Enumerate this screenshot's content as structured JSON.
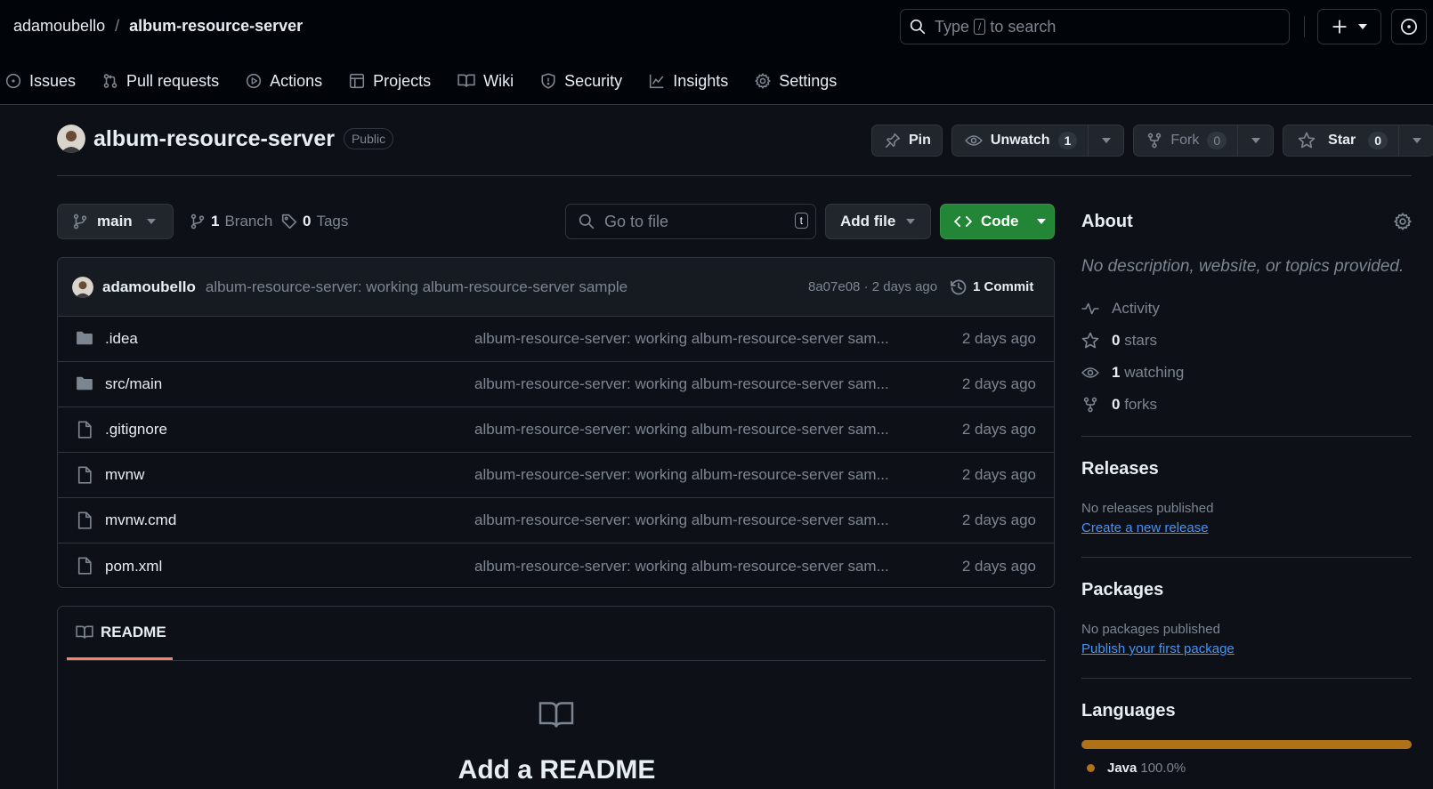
{
  "header": {
    "owner": "adamoubello",
    "separator": "/",
    "repo": "album-resource-server",
    "search_prefix": "Type",
    "search_key": "/",
    "search_suffix": "to search"
  },
  "nav_tabs": [
    {
      "label": "Issues",
      "icon": "issue-icon"
    },
    {
      "label": "Pull requests",
      "icon": "pull-request-icon"
    },
    {
      "label": "Actions",
      "icon": "play-icon"
    },
    {
      "label": "Projects",
      "icon": "table-icon"
    },
    {
      "label": "Wiki",
      "icon": "book-icon"
    },
    {
      "label": "Security",
      "icon": "shield-icon"
    },
    {
      "label": "Insights",
      "icon": "graph-icon"
    },
    {
      "label": "Settings",
      "icon": "gear-icon"
    }
  ],
  "repo_header": {
    "name": "album-resource-server",
    "visibility": "Public",
    "pin_label": "Pin",
    "watch_label": "Unwatch",
    "watch_count": "1",
    "fork_label": "Fork",
    "fork_count": "0",
    "star_label": "Star",
    "star_count": "0"
  },
  "toolbar": {
    "branch": "main",
    "branch_count": "1",
    "branch_label": "Branch",
    "tag_count": "0",
    "tag_label": "Tags",
    "goto_placeholder": "Go to file",
    "goto_key": "t",
    "add_file_label": "Add file",
    "code_label": "Code"
  },
  "latest_commit": {
    "author": "adamoubello",
    "message": "album-resource-server: working album-resource-server sample",
    "hash_time": "8a07e08 · 2 days ago",
    "commit_count": "1 Commit"
  },
  "files": [
    {
      "name": ".idea",
      "type": "folder",
      "message": "album-resource-server: working album-resource-server sam...",
      "date": "2 days ago"
    },
    {
      "name": "src/main",
      "type": "folder",
      "message": "album-resource-server: working album-resource-server sam...",
      "date": "2 days ago"
    },
    {
      "name": ".gitignore",
      "type": "file",
      "message": "album-resource-server: working album-resource-server sam...",
      "date": "2 days ago"
    },
    {
      "name": "mvnw",
      "type": "file",
      "message": "album-resource-server: working album-resource-server sam...",
      "date": "2 days ago"
    },
    {
      "name": "mvnw.cmd",
      "type": "file",
      "message": "album-resource-server: working album-resource-server sam...",
      "date": "2 days ago"
    },
    {
      "name": "pom.xml",
      "type": "file",
      "message": "album-resource-server: working album-resource-server sam...",
      "date": "2 days ago"
    }
  ],
  "readme": {
    "tab_label": "README",
    "title": "Add a README"
  },
  "sidebar": {
    "about_title": "About",
    "about_desc": "No description, website, or topics provided.",
    "activity_label": "Activity",
    "stars_count": "0",
    "stars_label": "stars",
    "watching_count": "1",
    "watching_label": "watching",
    "forks_count": "0",
    "forks_label": "forks",
    "releases_title": "Releases",
    "releases_sub": "No releases published",
    "releases_link": "Create a new release",
    "packages_title": "Packages",
    "packages_sub": "No packages published",
    "packages_link": "Publish your first package",
    "languages_title": "Languages",
    "language_name": "Java",
    "language_pct": "100.0%",
    "language_color": "#b07219"
  },
  "colors": {
    "bg": "#0d1117",
    "header_bg": "#010409",
    "border": "#30363d",
    "muted": "#7d8590",
    "accent_green": "#238636",
    "link": "#4493f8",
    "tab_underline": "#f78166"
  }
}
